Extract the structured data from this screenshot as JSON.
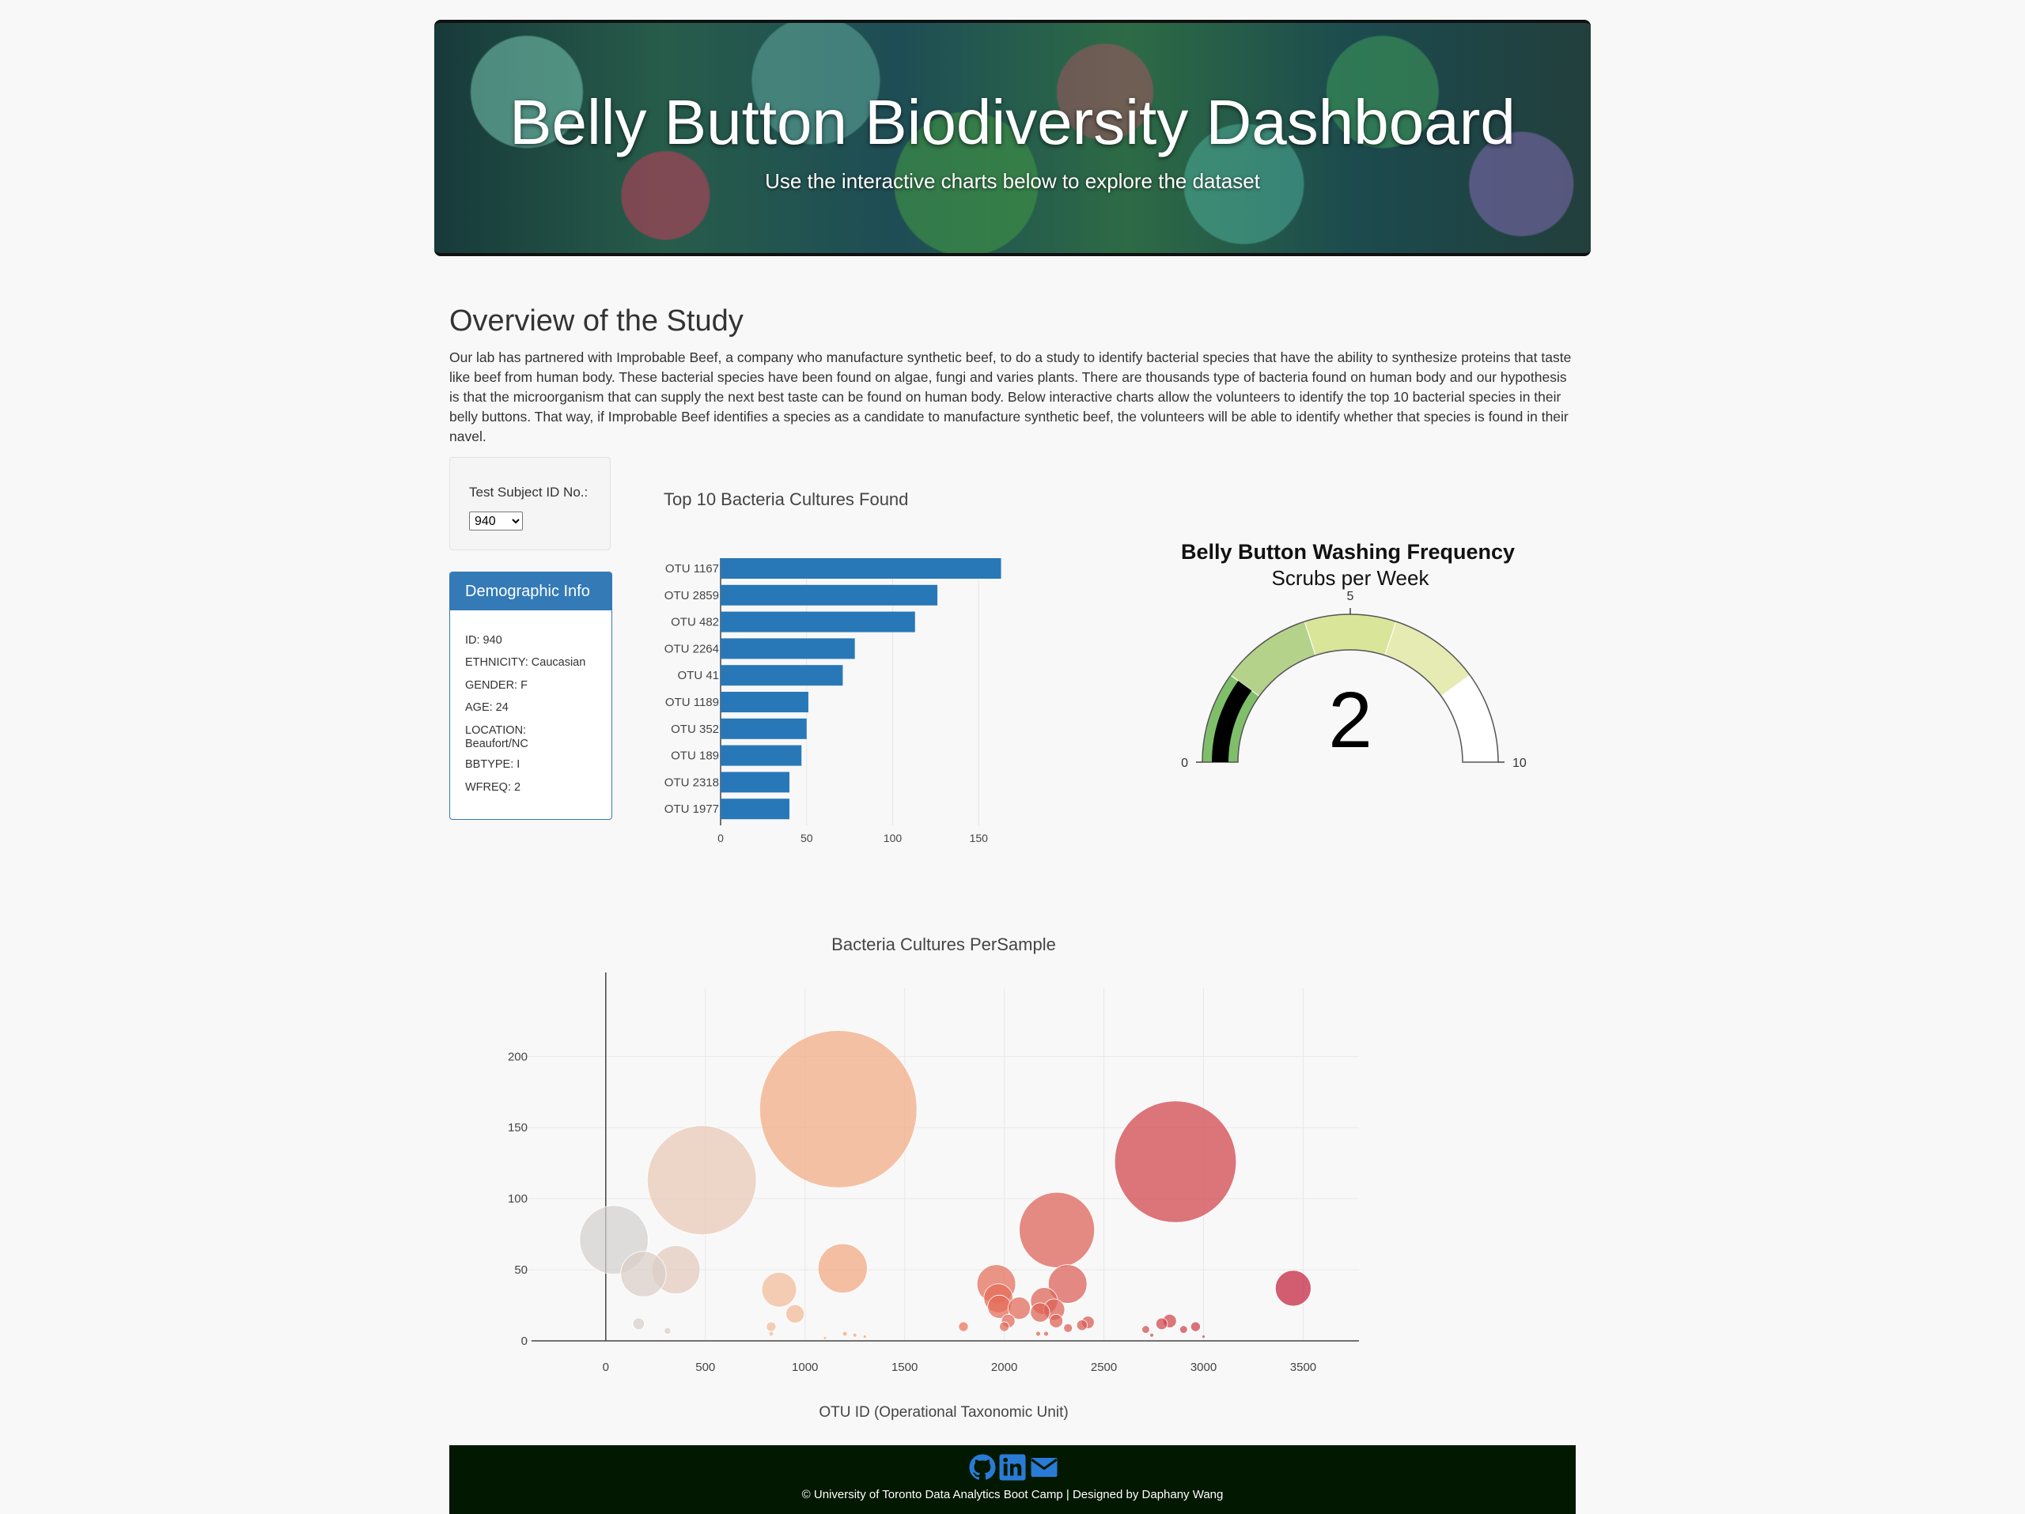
{
  "header": {
    "title": "Belly Button Biodiversity Dashboard",
    "subtitle": "Use the interactive charts below to explore the dataset"
  },
  "overview": {
    "title": "Overview of the Study",
    "body": "Our lab has partnered with Improbable Beef, a company who manufacture synthetic beef, to do a study to identify bacterial species that have the ability to synthesize proteins that taste like beef from human body. These bacterial species have been found on algae, fungi and varies plants. There are thousands type of bacteria found on human body and our hypothesis is that the microorganism that can supply the next best taste can be found on human body. Below interactive charts allow the volunteers to identify the top 10 bacterial species in their belly buttons. That way, if Improbable Beef identifies a species as a candidate to manufacture synthetic beef, the volunteers will be able to identify whether that species is found in their navel."
  },
  "selector": {
    "label": "Test Subject ID No.:",
    "selected": "940"
  },
  "demographics": {
    "title": "Demographic Info",
    "rows": [
      "ID: 940",
      "ETHNICITY: Caucasian",
      "GENDER: F",
      "AGE: 24",
      "LOCATION: Beaufort/NC",
      "BBTYPE: I",
      "WFREQ: 2"
    ]
  },
  "chart_data": [
    {
      "type": "bar",
      "orientation": "horizontal",
      "title": "Top 10 Bacteria Cultures Found",
      "categories": [
        "OTU 1167",
        "OTU 2859",
        "OTU 482",
        "OTU 2264",
        "OTU 41",
        "OTU 1189",
        "OTU 352",
        "OTU 189",
        "OTU 2318",
        "OTU 1977"
      ],
      "values": [
        163,
        126,
        113,
        78,
        71,
        51,
        50,
        47,
        40,
        40
      ],
      "xticks": [
        "0",
        "50",
        "100",
        "150"
      ],
      "xlim": [
        0,
        170
      ],
      "color": "#2878b8",
      "grid": true
    },
    {
      "type": "gauge",
      "title": "Belly Button Washing Frequency",
      "subtitle": "Scrubs per Week",
      "value": 2,
      "value_label": "2",
      "range": [
        0,
        10
      ],
      "tick_labels": [
        "0",
        "5",
        "10"
      ],
      "bands": [
        {
          "from": 0,
          "to": 2,
          "color": "#7fbf6a"
        },
        {
          "from": 2,
          "to": 4,
          "color": "#b5d28a"
        },
        {
          "from": 4,
          "to": 6,
          "color": "#d9e69a"
        },
        {
          "from": 6,
          "to": 8,
          "color": "#e6ebb4"
        },
        {
          "from": 8,
          "to": 10,
          "color": "#ffffff"
        }
      ],
      "bar_color": "#000000"
    },
    {
      "type": "scatter",
      "subtype": "bubble",
      "title": "Bacteria Cultures PerSample",
      "xlabel": "OTU ID (Operational Taxonomic Unit)",
      "xticks": [
        "0",
        "500",
        "1000",
        "1500",
        "2000",
        "2500",
        "3000",
        "3500"
      ],
      "yticks": [
        "0",
        "50",
        "100",
        "150",
        "200"
      ],
      "xlim": [
        -420,
        3780
      ],
      "ylim": [
        -5,
        248
      ],
      "grid": true,
      "points": [
        {
          "x": 41,
          "y": 71
        },
        {
          "x": 189,
          "y": 47
        },
        {
          "x": 352,
          "y": 50
        },
        {
          "x": 482,
          "y": 113
        },
        {
          "x": 165,
          "y": 12
        },
        {
          "x": 310,
          "y": 7
        },
        {
          "x": 1167,
          "y": 163
        },
        {
          "x": 1189,
          "y": 51
        },
        {
          "x": 870,
          "y": 36
        },
        {
          "x": 950,
          "y": 19
        },
        {
          "x": 830,
          "y": 10
        },
        {
          "x": 830,
          "y": 5
        },
        {
          "x": 1200,
          "y": 5
        },
        {
          "x": 1250,
          "y": 4
        },
        {
          "x": 1300,
          "y": 3
        },
        {
          "x": 1100,
          "y": 2
        },
        {
          "x": 1795,
          "y": 10
        },
        {
          "x": 1960,
          "y": 40
        },
        {
          "x": 1970,
          "y": 30
        },
        {
          "x": 1975,
          "y": 24
        },
        {
          "x": 2075,
          "y": 23
        },
        {
          "x": 2020,
          "y": 14
        },
        {
          "x": 2000,
          "y": 10
        },
        {
          "x": 2264,
          "y": 78
        },
        {
          "x": 2200,
          "y": 28
        },
        {
          "x": 2180,
          "y": 20
        },
        {
          "x": 2250,
          "y": 22
        },
        {
          "x": 2318,
          "y": 40
        },
        {
          "x": 2260,
          "y": 14
        },
        {
          "x": 2320,
          "y": 9
        },
        {
          "x": 2420,
          "y": 13
        },
        {
          "x": 2390,
          "y": 11
        },
        {
          "x": 2210,
          "y": 5
        },
        {
          "x": 2170,
          "y": 5
        },
        {
          "x": 2859,
          "y": 126
        },
        {
          "x": 2710,
          "y": 8
        },
        {
          "x": 2790,
          "y": 12
        },
        {
          "x": 2830,
          "y": 14
        },
        {
          "x": 2900,
          "y": 8
        },
        {
          "x": 2960,
          "y": 10
        },
        {
          "x": 2740,
          "y": 4
        },
        {
          "x": 3000,
          "y": 3
        },
        {
          "x": 3450,
          "y": 37
        }
      ]
    }
  ],
  "footer": {
    "text": "© University of Toronto Data Analytics Boot Camp | Designed by Daphany Wang",
    "icons": [
      "github-icon",
      "linkedin-icon",
      "email-icon"
    ],
    "icon_color": "#2a7bd6"
  }
}
